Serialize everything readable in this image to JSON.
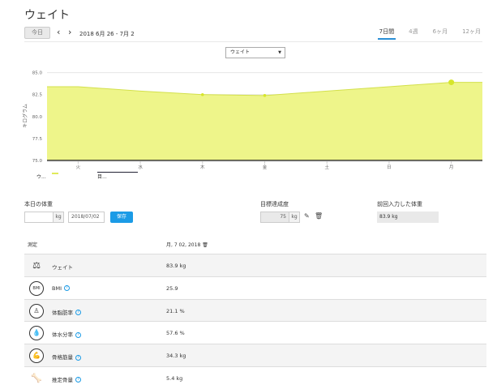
{
  "page_title": "ウェイト",
  "toolbar": {
    "today_label": "今日",
    "prev_icon": "‹",
    "next_icon": "›",
    "date_range": "2018 6月 26 - 7月 2"
  },
  "period_tabs": [
    {
      "label": "7日間",
      "active": true
    },
    {
      "label": "4週",
      "active": false
    },
    {
      "label": "6ヶ月",
      "active": false
    },
    {
      "label": "12ヶ月",
      "active": false
    }
  ],
  "metric_select": {
    "value": "ウェイト"
  },
  "chart_data": {
    "type": "area",
    "ylabel": "キログラム",
    "ylim": [
      75,
      85
    ],
    "yticks": [
      "85.0",
      "82.5",
      "80.0",
      "77.5",
      "75.0"
    ],
    "categories": [
      "火",
      "水",
      "木",
      "金",
      "土",
      "日",
      "月"
    ],
    "series": [
      {
        "values": [
          83.4,
          82.9,
          82.5,
          82.4,
          82.9,
          83.4,
          83.9
        ],
        "points_marked": [
          false,
          false,
          true,
          true,
          false,
          false,
          true
        ]
      },
      {
        "values": [
          75,
          75,
          75,
          75,
          75,
          75,
          75
        ]
      }
    ],
    "colors": {
      "fill": "#eef58a",
      "stroke": "#d3e04c",
      "marker": "#d6e62a",
      "goal": "#222222"
    },
    "grid": true
  },
  "legend": {
    "series_a": "ウ...",
    "series_b": "目..."
  },
  "todays_weight": {
    "label": "本日の体重",
    "weight_value": "",
    "unit": "kg",
    "date_value": "2018/07/02",
    "save_label": "保存"
  },
  "goal": {
    "label": "目標達成度",
    "value": "75",
    "unit": "kg"
  },
  "last_entry": {
    "label": "前回入力した体重",
    "value": "83.9 kg"
  },
  "table": {
    "header_metric": "測定",
    "header_date": "月, 7 02, 2018",
    "rows": [
      {
        "icon": "weight-icon",
        "glyph": "⚖",
        "name": "ウェイト",
        "info": false,
        "value": "83.9  kg"
      },
      {
        "icon": "bmi-icon",
        "glyph": "BMI",
        "name": "BMI",
        "info": true,
        "value": "25.9"
      },
      {
        "icon": "body-fat-icon",
        "glyph": "♙",
        "name": "体脂肪率",
        "info": true,
        "value": "21.1  %"
      },
      {
        "icon": "body-water-icon",
        "glyph": "💧",
        "name": "体水分率",
        "info": true,
        "value": "57.6  %"
      },
      {
        "icon": "muscle-mass-icon",
        "glyph": "💪",
        "name": "骨格筋量",
        "info": true,
        "value": "34.3  kg"
      },
      {
        "icon": "bone-mass-icon",
        "glyph": "🦴",
        "name": "推定骨量",
        "info": true,
        "value": "5.4  kg"
      }
    ]
  }
}
